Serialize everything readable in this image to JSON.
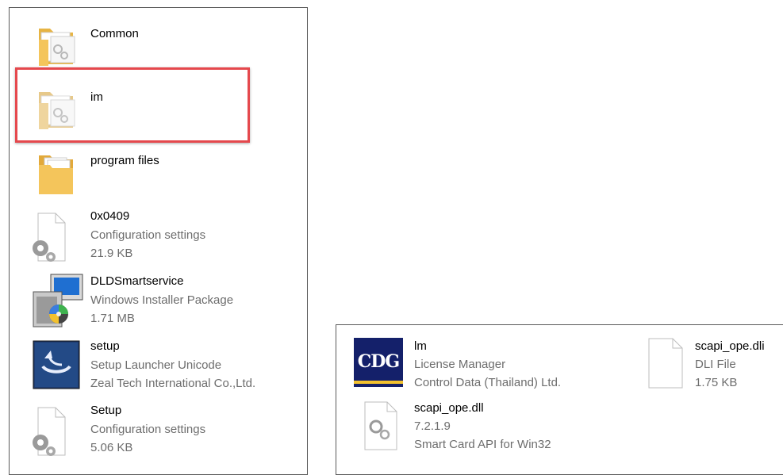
{
  "files": [
    {
      "name": "Common",
      "icon": "folder-settings-icon"
    },
    {
      "name": "im",
      "icon": "folder-settings-icon"
    },
    {
      "name": "program files",
      "icon": "folder-files-icon"
    },
    {
      "name": "0x0409",
      "type": "Configuration settings",
      "size": "21.9 KB",
      "icon": "config-file-icon"
    },
    {
      "name": "DLDSmartservice",
      "type": "Windows Installer Package",
      "size": "1.71 MB",
      "icon": "installer-package-icon"
    },
    {
      "name": "setup",
      "type": "Setup Launcher Unicode",
      "company": "Zeal Tech International Co.,Ltd.",
      "icon": "setup-launcher-icon"
    },
    {
      "name": "Setup",
      "type": "Configuration settings",
      "size": "5.06 KB",
      "icon": "config-file-icon"
    }
  ],
  "right_files": [
    {
      "name": "lm",
      "description": "License Manager",
      "company": "Control Data (Thailand) Ltd.",
      "icon": "cdg-logo-icon",
      "logo_text": "CDG"
    },
    {
      "name": "scapi_ope.dli",
      "type": "DLI File",
      "size": "1.75 KB",
      "icon": "blank-file-icon"
    },
    {
      "name": "scapi_ope.dll",
      "version": "7.2.1.9",
      "description": "Smart Card API for Win32",
      "icon": "dll-file-icon"
    }
  ],
  "colors": {
    "highlight": "#e5484d",
    "folder": "#f4c55b",
    "meta_text": "#6d6d6d",
    "cdg_blue": "#14206a"
  }
}
